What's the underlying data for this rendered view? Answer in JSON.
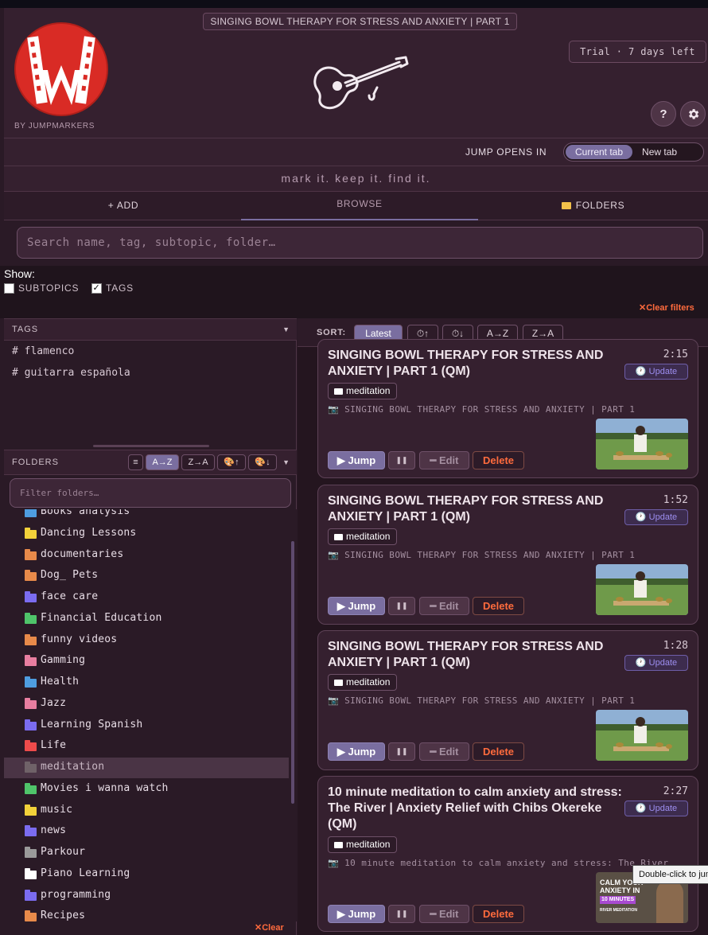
{
  "header": {
    "video_title": "SINGING BOWL THERAPY FOR STRESS AND ANXIETY | PART 1",
    "logo_byline": "BY JUMPMARKERS",
    "trial": "Trial · 7 days left",
    "help_icon": "?",
    "settings_icon": "gear-icon"
  },
  "jump": {
    "label": "JUMP OPENS IN",
    "options": [
      "Current tab",
      "New tab"
    ],
    "selected": "Current tab"
  },
  "tagline": "mark it. keep it. find it.",
  "tabs": {
    "add": "+ ADD",
    "browse": "BROWSE",
    "folders": "FOLDERS",
    "active": "BROWSE"
  },
  "search": {
    "placeholder": "Search name, tag, subtopic, folder…",
    "value": ""
  },
  "show": {
    "label": "Show:",
    "subtopics": "SUBTOPICS",
    "subtopics_checked": false,
    "tags": "TAGS",
    "tags_checked": true,
    "clear_filters": "Clear filters"
  },
  "tags_panel": {
    "title": "TAGS",
    "items": [
      "# flamenco",
      "# guitarra española"
    ]
  },
  "folders_panel": {
    "title": "FOLDERS",
    "sort_buttons": [
      "≡",
      "A→Z",
      "Z→A",
      "🎨↑",
      "🎨↓"
    ],
    "active_sort": "A→Z",
    "filter_placeholder": "Filter folders…",
    "clear": "Clear",
    "items": [
      {
        "name": "Books analysis",
        "color": "#4e9de0"
      },
      {
        "name": "Dancing Lessons",
        "color": "#f2d13a"
      },
      {
        "name": "documentaries",
        "color": "#e88a4a"
      },
      {
        "name": "Dog_ Pets",
        "color": "#e88a4a"
      },
      {
        "name": "face care",
        "color": "#7b6cf0"
      },
      {
        "name": "Financial Education",
        "color": "#4fc46a"
      },
      {
        "name": "funny videos",
        "color": "#e88a4a"
      },
      {
        "name": "Gamming",
        "color": "#e87ea0"
      },
      {
        "name": "Health",
        "color": "#4e9de0"
      },
      {
        "name": "Jazz",
        "color": "#e87ea0"
      },
      {
        "name": "Learning Spanish",
        "color": "#7b6cf0"
      },
      {
        "name": "Life",
        "color": "#ee4b4b"
      },
      {
        "name": "meditation",
        "color": "#6f6268",
        "selected": true
      },
      {
        "name": "Movies i wanna watch",
        "color": "#4fc46a"
      },
      {
        "name": "music",
        "color": "#f2d13a"
      },
      {
        "name": "news",
        "color": "#7b6cf0"
      },
      {
        "name": "Parkour",
        "color": "#9a9a9a"
      },
      {
        "name": "Piano Learning",
        "color": "#ffffff"
      },
      {
        "name": "programming",
        "color": "#7b6cf0"
      },
      {
        "name": "Recipes",
        "color": "#e88a4a"
      }
    ]
  },
  "sort": {
    "label": "SORT:",
    "buttons": [
      "Latest",
      "⏱↑",
      "⏱↓",
      "A→Z",
      "Z→A"
    ],
    "active": "Latest"
  },
  "cards": [
    {
      "title": "SINGING BOWL THERAPY FOR STRESS AND ANXIETY | PART 1 (QM)",
      "duration": "2:15",
      "update": "Update",
      "tag": "meditation",
      "subtitle": "SINGING BOWL THERAPY FOR STRESS AND ANXIETY | PART 1",
      "buttons": {
        "jump": "▶ Jump",
        "pause": "❚❚",
        "edit": "━ Edit",
        "delete": "Delete"
      }
    },
    {
      "title": "SINGING BOWL THERAPY FOR STRESS AND ANXIETY | PART 1 (QM)",
      "duration": "1:52",
      "update": "Update",
      "tag": "meditation",
      "subtitle": "SINGING BOWL THERAPY FOR STRESS AND ANXIETY | PART 1",
      "buttons": {
        "jump": "▶ Jump",
        "pause": "❚❚",
        "edit": "━ Edit",
        "delete": "Delete"
      }
    },
    {
      "title": "SINGING BOWL THERAPY FOR STRESS AND ANXIETY | PART 1 (QM)",
      "duration": "1:28",
      "update": "Update",
      "tag": "meditation",
      "subtitle": "SINGING BOWL THERAPY FOR STRESS AND ANXIETY | PART 1",
      "buttons": {
        "jump": "▶ Jump",
        "pause": "❚❚",
        "edit": "━ Edit",
        "delete": "Delete"
      }
    },
    {
      "title": "10 minute meditation to calm anxiety and stress: The River | Anxiety Relief with Chibs Okereke (QM)",
      "duration": "2:27",
      "update": "Update",
      "tag": "meditation",
      "subtitle": "10 minute meditation to calm anxiety and stress: The River",
      "thumb_text": [
        "CALM YOUR",
        "ANXIETY IN",
        "10 MINUTES",
        "RIVER MEDITATION"
      ],
      "buttons": {
        "jump": "▶ Jump",
        "pause": "❚❚",
        "edit": "━ Edit",
        "delete": "Delete"
      }
    }
  ],
  "tooltip": "Double-click to jump",
  "colors": {
    "accent": "#7a6ea0",
    "danger": "#ff6b3d",
    "update": "#9d8ef0",
    "background": "#2a1a26"
  }
}
